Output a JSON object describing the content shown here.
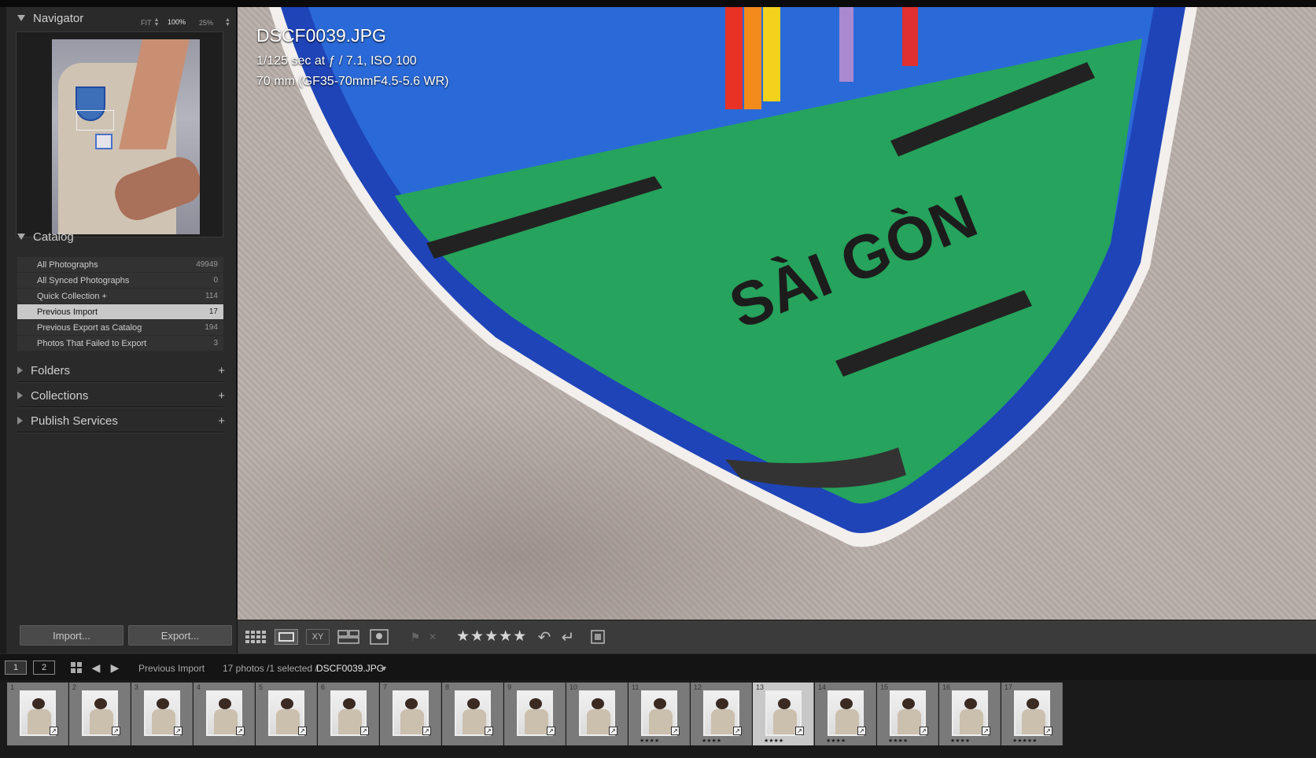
{
  "navigator": {
    "title": "Navigator",
    "zoom_fit": "FIT",
    "zoom_100": "100%",
    "zoom_25": "25%"
  },
  "catalog": {
    "title": "Catalog",
    "items": [
      {
        "label": "All Photographs",
        "count": "49949"
      },
      {
        "label": "All Synced Photographs",
        "count": "0"
      },
      {
        "label": "Quick Collection +",
        "count": "114"
      },
      {
        "label": "Previous Import",
        "count": "17"
      },
      {
        "label": "Previous Export as Catalog",
        "count": "194"
      },
      {
        "label": "Photos That Failed to Export",
        "count": "3"
      }
    ]
  },
  "panels": {
    "folders": "Folders",
    "collections": "Collections",
    "publish": "Publish Services",
    "plus": "+"
  },
  "buttons": {
    "import": "Import...",
    "export": "Export..."
  },
  "image_info": {
    "filename": "DSCF0039.JPG",
    "exposure": "1/125 sec at ƒ / 7.1, ISO 100",
    "lens": "70 mm (GF35-70mmF4.5-5.6 WR)",
    "patch_text": "SÀI GÒN"
  },
  "toolbar": {
    "stars": "★★★★★",
    "rating": 4
  },
  "filmstrip_header": {
    "monitor1": "1",
    "monitor2": "2",
    "source": "Previous Import",
    "count_text": "17 photos /1 selected /",
    "selected_file": "DSCF0039.JPG"
  },
  "filmstrip": {
    "cells": [
      {
        "idx": "1",
        "rating": ""
      },
      {
        "idx": "2",
        "rating": ""
      },
      {
        "idx": "3",
        "rating": ""
      },
      {
        "idx": "4",
        "rating": ""
      },
      {
        "idx": "5",
        "rating": ""
      },
      {
        "idx": "6",
        "rating": ""
      },
      {
        "idx": "7",
        "rating": ""
      },
      {
        "idx": "8",
        "rating": ""
      },
      {
        "idx": "9",
        "rating": ""
      },
      {
        "idx": "10",
        "rating": ""
      },
      {
        "idx": "11",
        "rating": "★★★★"
      },
      {
        "idx": "12",
        "rating": "★★★★"
      },
      {
        "idx": "13",
        "rating": "★★★★"
      },
      {
        "idx": "14",
        "rating": "★★★★"
      },
      {
        "idx": "15",
        "rating": "★★★★"
      },
      {
        "idx": "16",
        "rating": "★★★★"
      },
      {
        "idx": "17",
        "rating": "★★★★★"
      }
    ],
    "selected_index": 12
  },
  "colors": {
    "panel_bg": "#2a2a2a",
    "selected_row": "#c8c8c8",
    "patch_blue": "#1f4fc4",
    "patch_green": "#24a85a"
  }
}
